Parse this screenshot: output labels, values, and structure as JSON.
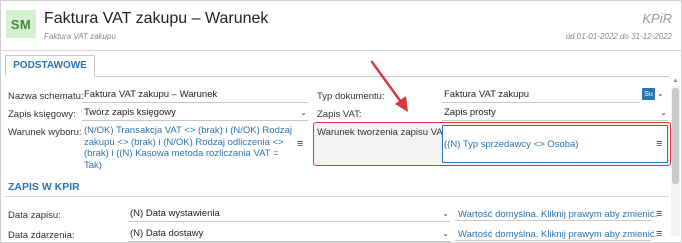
{
  "header": {
    "badge": "SM",
    "title": "Faktura VAT zakupu – Warunek",
    "subtitle": "Faktura VAT zakupu",
    "module": "KPiR",
    "period": "od 01-01-2022 do 31-12-2022"
  },
  "tabs": [
    {
      "label": "PODSTAWOWE",
      "active": true
    }
  ],
  "form": {
    "schema_name": {
      "label": "Nazwa schematu:",
      "value": "Faktura VAT zakupu – Warunek"
    },
    "document_type": {
      "label": "Typ dokumentu:",
      "value": "Faktura VAT zakupu",
      "badge": "Su"
    },
    "book_entry": {
      "label": "Zapis księgowy:",
      "value": "Twórz zapis księgowy"
    },
    "vat_entry": {
      "label": "Zapis VAT:",
      "value": "Zapis prosty"
    },
    "selection_condition": {
      "label": "Warunek wyboru:",
      "value": "(N/OK) Transakcja VAT <> (brak) i (N/OK) Rodzaj zakupu <> (brak) i (N/OK) Rodzaj odliczenia <> (brak) i ((N) Kasowa metoda rozliczania VAT = Tak)"
    },
    "vat_entry_condition": {
      "label": "Warunek tworzenia zapisu VAT:",
      "value": "((N) Typ sprzedawcy <> Osoba)"
    }
  },
  "kpir_section": {
    "title": "ZAPIS W KPIR",
    "rows": [
      {
        "label": "Data zapisu:",
        "value": "(N) Data wystawienia",
        "hint": "Wartość domyślna. Kliknij prawym aby zmienić."
      },
      {
        "label": "Data zdarzenia:",
        "value": "(N) Data dostawy",
        "hint": "Wartość domyślna. Kliknij prawym aby zmienić."
      }
    ]
  },
  "colors": {
    "accent": "#2a75b3",
    "highlight": "#d9363e",
    "badge_bg": "#d7eed3",
    "badge_fg": "#3d8b40"
  },
  "icons": {
    "menu": "≡",
    "chevron": "⌄"
  }
}
